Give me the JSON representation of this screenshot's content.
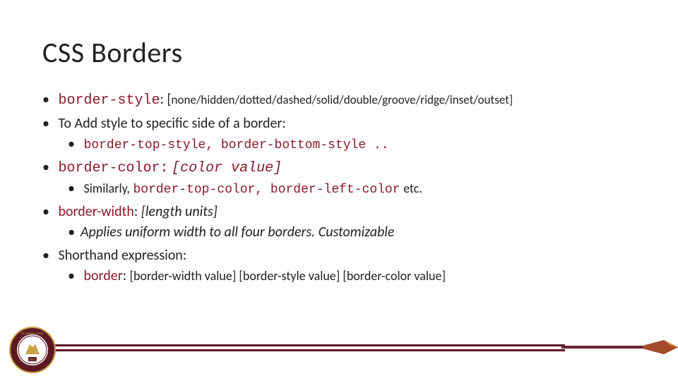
{
  "title": "CSS Borders",
  "bullets": {
    "b1_prop": "border-style",
    "b1_vals": "none/hidden/dotted/dashed/solid/double/groove/ridge/inset/outset]",
    "b2": "To Add style to specific side of a border:",
    "b2_sub": "border-top-style, border-bottom-style ..",
    "b3_prop": "border-color:",
    "b3_val": "[color value]",
    "b3_sub_pre": "Similarly,",
    "b3_sub_code": "border-top-color, border-left-color",
    "b3_sub_post": "etc.",
    "b4_prop": "border-width",
    "b4_val": "[length units]",
    "b4_sub": "Applies uniform width to all four borders. Customizable",
    "b5": "Shorthand expression:",
    "b5_sub_prop": "border",
    "b5_sub_vals": "[border-width value] [border-style value] [border-color value]"
  },
  "footer": {
    "seal_label": "FSU Seal 1851"
  }
}
